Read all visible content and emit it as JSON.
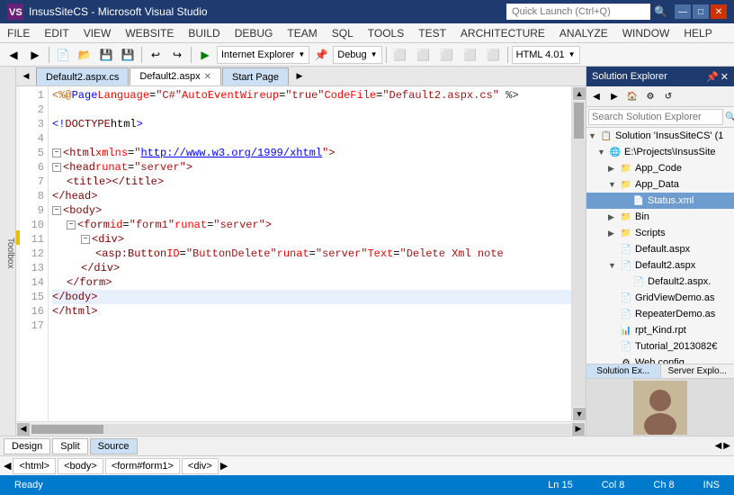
{
  "titleBar": {
    "logo": "VS",
    "title": "InsusSiteCS - Microsoft Visual Studio",
    "search": "Quick Launch (Ctrl+Q)",
    "buttons": [
      "—",
      "□",
      "✕"
    ]
  },
  "menuBar": {
    "items": [
      "FILE",
      "EDIT",
      "VIEW",
      "WEBSITE",
      "BUILD",
      "DEBUG",
      "TEAM",
      "SQL",
      "TOOLS",
      "TEST",
      "ARCHITECTURE",
      "ANALYZE",
      "WINDOW",
      "HELP"
    ]
  },
  "toolbar": {
    "browserLabel": "Internet Explorer",
    "debugLabel": "Debug",
    "htmlVersion": "HTML 4.01"
  },
  "tabs": {
    "items": [
      "Default2.aspx.cs",
      "Default2.aspx",
      "Start Page"
    ],
    "activeIndex": 1
  },
  "code": {
    "lines": [
      {
        "num": 1,
        "indent": 0,
        "content": "<%@ Page Language=\"C#\" AutoEventWireup=\"true\" CodeFile=\"Default2.aspx.cs\"",
        "hasCollapse": false,
        "highlighted": false
      },
      {
        "num": 2,
        "indent": 0,
        "content": "",
        "hasCollapse": false,
        "highlighted": false
      },
      {
        "num": 3,
        "indent": 0,
        "content": "<!DOCTYPE html>",
        "hasCollapse": false,
        "highlighted": false
      },
      {
        "num": 4,
        "indent": 0,
        "content": "",
        "hasCollapse": false,
        "highlighted": false
      },
      {
        "num": 5,
        "indent": 0,
        "content": "<html xmlns=\"http://www.w3.org/1999/xhtml\">",
        "hasCollapse": true,
        "highlighted": false
      },
      {
        "num": 6,
        "indent": 0,
        "content": "<head runat=\"server\">",
        "hasCollapse": true,
        "highlighted": false
      },
      {
        "num": 7,
        "indent": 1,
        "content": "<title></title>",
        "hasCollapse": false,
        "highlighted": false
      },
      {
        "num": 8,
        "indent": 0,
        "content": "</head>",
        "hasCollapse": false,
        "highlighted": false
      },
      {
        "num": 9,
        "indent": 0,
        "content": "<body>",
        "hasCollapse": true,
        "highlighted": false
      },
      {
        "num": 10,
        "indent": 1,
        "content": "<form id=\"form1\" runat=\"server\">",
        "hasCollapse": true,
        "highlighted": false
      },
      {
        "num": 11,
        "indent": 2,
        "content": "<div>",
        "hasCollapse": true,
        "highlighted": false
      },
      {
        "num": 12,
        "indent": 3,
        "content": "<asp:Button ID=\"ButtonDelete\" runat=\"server\" Text=\"Delete Xml note",
        "hasCollapse": false,
        "highlighted": false
      },
      {
        "num": 13,
        "indent": 2,
        "content": "</div>",
        "hasCollapse": false,
        "highlighted": false
      },
      {
        "num": 14,
        "indent": 1,
        "content": "</form>",
        "hasCollapse": false,
        "highlighted": false
      },
      {
        "num": 15,
        "indent": 0,
        "content": "</body>",
        "hasCollapse": false,
        "highlighted": true
      },
      {
        "num": 16,
        "indent": 0,
        "content": "</html>",
        "hasCollapse": false,
        "highlighted": false
      },
      {
        "num": 17,
        "indent": 0,
        "content": "",
        "hasCollapse": false,
        "highlighted": false
      }
    ]
  },
  "solutionExplorer": {
    "title": "Solution Explorer",
    "searchPlaceholder": "Search Solution Explorer",
    "tree": [
      {
        "level": 0,
        "label": "Solution 'InsusSiteCS' (1",
        "type": "solution",
        "expanded": true
      },
      {
        "level": 1,
        "label": "E:\\Projects\\InsusSite",
        "type": "project",
        "expanded": true
      },
      {
        "level": 2,
        "label": "App_Code",
        "type": "folder",
        "expanded": false
      },
      {
        "level": 2,
        "label": "App_Data",
        "type": "folder",
        "expanded": true
      },
      {
        "level": 3,
        "label": "Status.xml",
        "type": "file-xml",
        "selected": true
      },
      {
        "level": 2,
        "label": "Bin",
        "type": "folder",
        "expanded": false
      },
      {
        "level": 2,
        "label": "Scripts",
        "type": "folder",
        "expanded": false
      },
      {
        "level": 2,
        "label": "Default.aspx",
        "type": "file-aspx",
        "expanded": false
      },
      {
        "level": 2,
        "label": "Default2.aspx",
        "type": "file-aspx",
        "expanded": true
      },
      {
        "level": 3,
        "label": "Default2.aspx.",
        "type": "file-cs"
      },
      {
        "level": 2,
        "label": "GridViewDemo.as",
        "type": "file-aspx"
      },
      {
        "level": 2,
        "label": "RepeaterDemo.as",
        "type": "file-aspx"
      },
      {
        "level": 2,
        "label": "rpt_Kind.rpt",
        "type": "file-rpt"
      },
      {
        "level": 2,
        "label": "Tutorial_2013082€",
        "type": "file"
      },
      {
        "level": 2,
        "label": "Web.config",
        "type": "file-config"
      }
    ]
  },
  "bottomTabs": {
    "items": [
      "Design",
      "Split",
      "Source"
    ],
    "activeLabel": "Source"
  },
  "navBar": {
    "items": [
      "<html>",
      "<body>",
      "<form#form1>",
      "<div>"
    ]
  },
  "statusBar": {
    "ready": "Ready",
    "line": "Ln 15",
    "col": "Col 8",
    "ch": "Ch 8",
    "ins": "INS"
  },
  "seTabs": {
    "left": "Solution Ex...",
    "right": "Server Explo..."
  }
}
